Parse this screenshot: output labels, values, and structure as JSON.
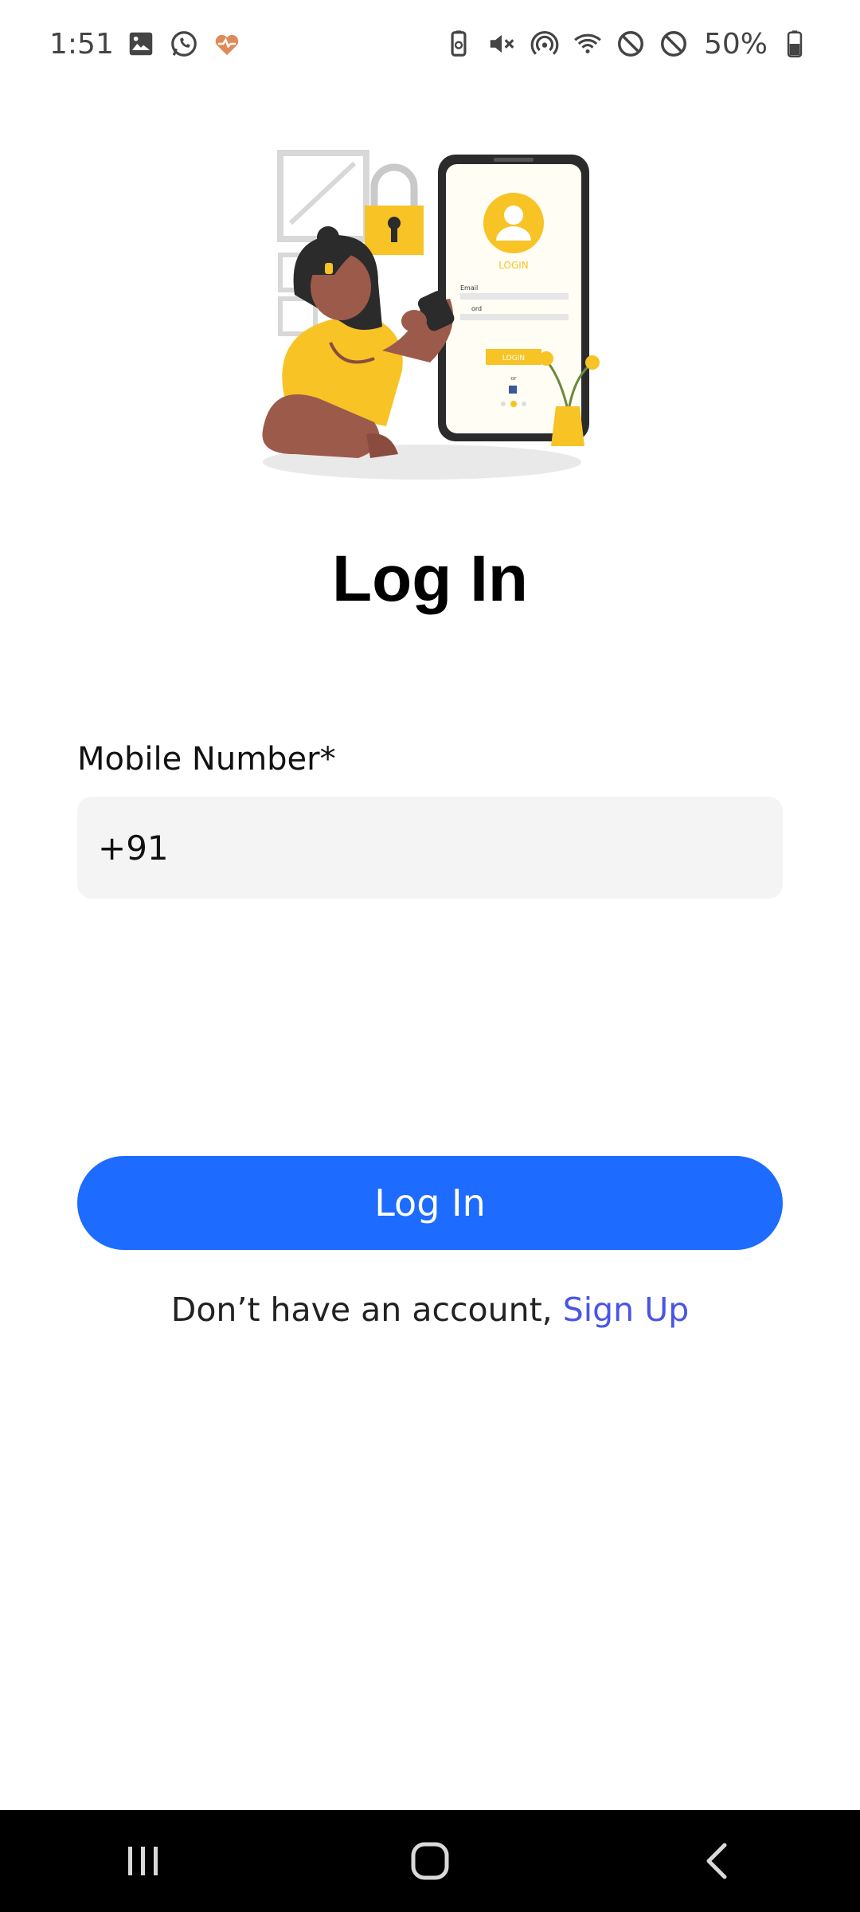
{
  "status_bar": {
    "time": "1:51",
    "battery_percent": "50%",
    "left_icons": [
      "gallery-icon",
      "whatsapp-icon",
      "health-icon"
    ],
    "right_icons": [
      "battery-saver-icon",
      "mute-icon",
      "hotspot-icon",
      "wifi-icon",
      "do-not-disturb-icon",
      "blocked-icon",
      "battery-icon"
    ]
  },
  "illustration": {
    "screen_title": "LOGIN",
    "email_label": "Email",
    "password_label": "ord",
    "button_label": "LOGIN",
    "or_label": "or"
  },
  "page": {
    "title": "Log In"
  },
  "form": {
    "mobile_label": "Mobile Number*",
    "mobile_value": "+91"
  },
  "actions": {
    "login_label": "Log In",
    "signup_prompt": "Don’t have an account, ",
    "signup_link": "Sign Up"
  },
  "colors": {
    "accent": "#1d6bff",
    "link": "#4a55e6",
    "illustration_yellow": "#f7c325"
  },
  "nav_bar": {
    "buttons": [
      "recents-icon",
      "home-icon",
      "back-icon"
    ]
  }
}
